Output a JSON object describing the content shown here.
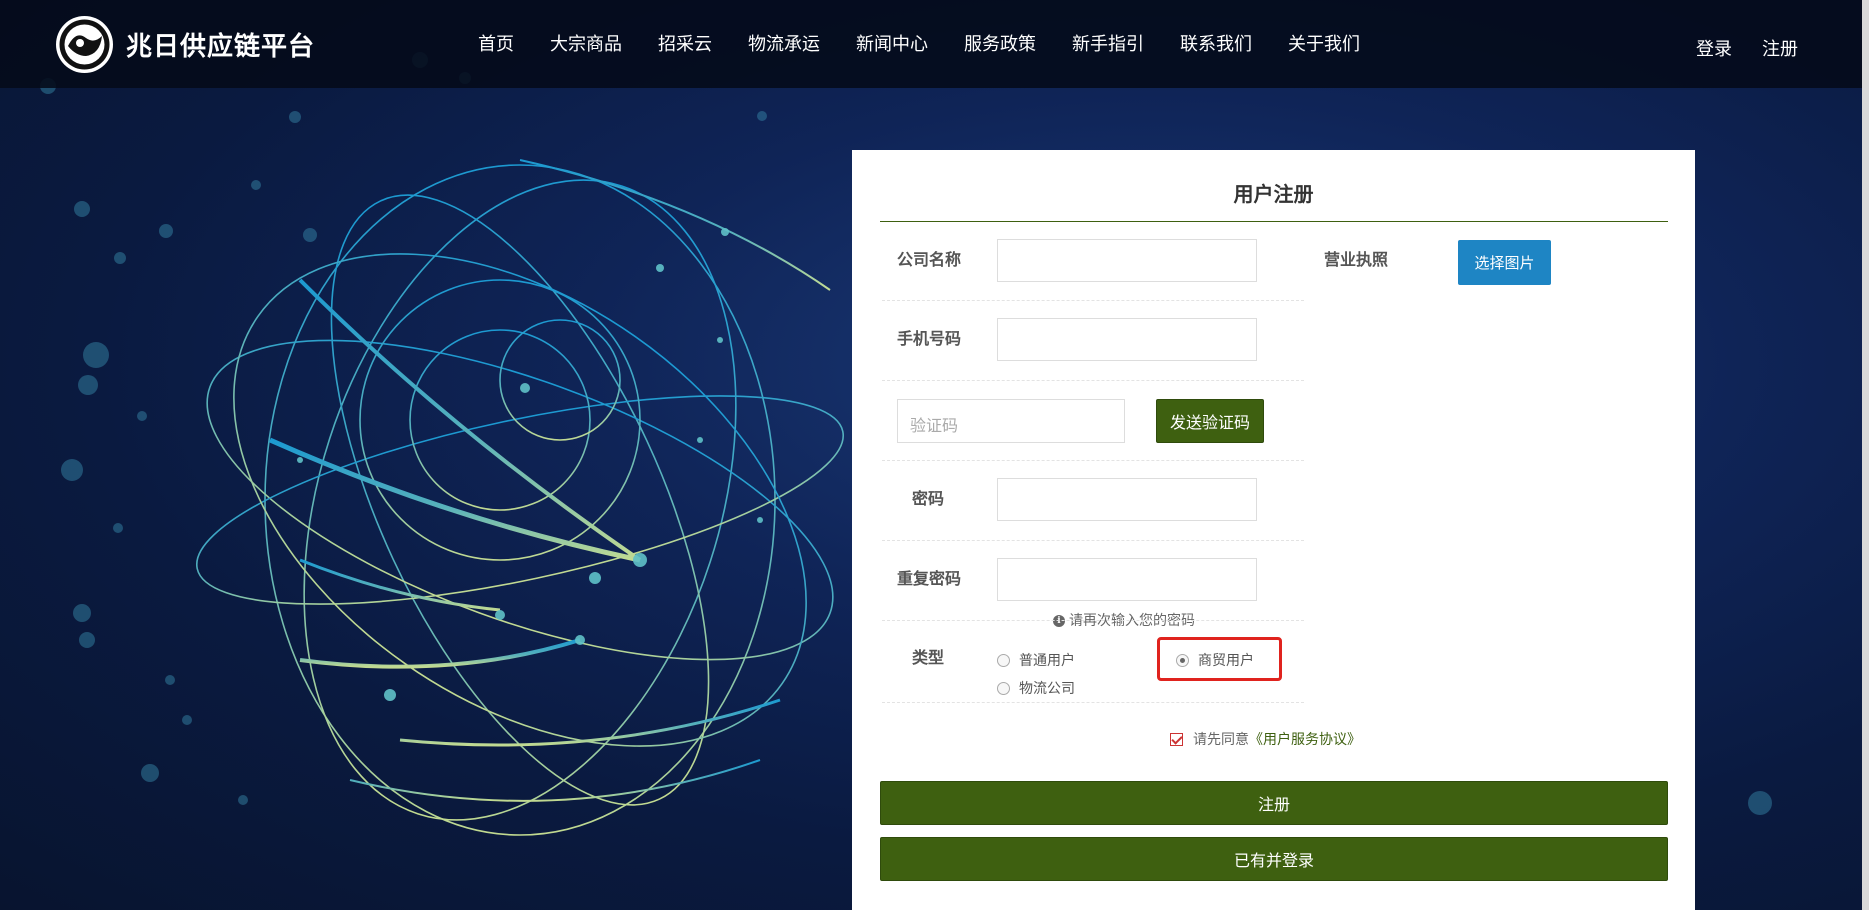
{
  "header": {
    "brand": "兆日供应链平台",
    "nav": [
      "首页",
      "大宗商品",
      "招采云",
      "物流承运",
      "新闻中心",
      "服务政策",
      "新手指引",
      "联系我们",
      "关于我们"
    ],
    "login": "登录",
    "register": "注册"
  },
  "form": {
    "title": "用户注册",
    "company_label": "公司名称",
    "license_label": "营业执照",
    "choose_image": "选择图片",
    "phone_label": "手机号码",
    "code_placeholder": "验证码",
    "send_code": "发送验证码",
    "password_label": "密码",
    "repeat_label": "重复密码",
    "repeat_hint": "请再次输入您的密码",
    "type_label": "类型",
    "types": [
      {
        "label": "普通用户",
        "selected": false
      },
      {
        "label": "商贸用户",
        "selected": true
      },
      {
        "label": "物流公司",
        "selected": false
      }
    ],
    "agree_prefix": "请先同意",
    "agree_link": "《用户服务协议》",
    "agree_checked": true,
    "register_button": "注册",
    "login_button": "已有并登录"
  },
  "colors": {
    "primary_green": "#3e6010",
    "image_button_blue": "#1e85c4",
    "highlight_red": "#e0231e"
  },
  "icons": [
    "info-icon",
    "check-icon",
    "radio-icon"
  ]
}
